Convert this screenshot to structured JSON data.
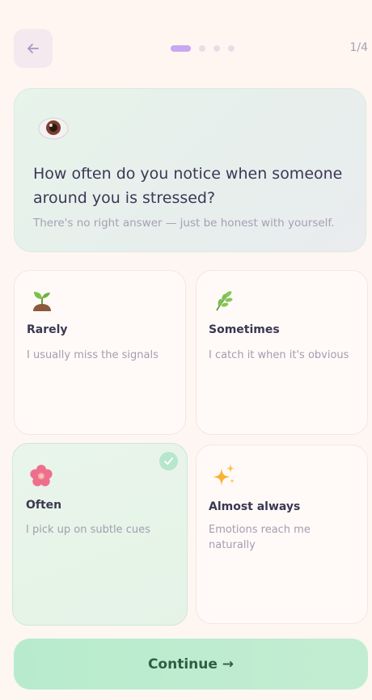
{
  "header": {
    "step_label": "1/4",
    "progress": {
      "current": 1,
      "total": 4
    }
  },
  "question": {
    "icon": "eye-icon",
    "title": "How often do you notice when someone around you is stressed?",
    "subtitle": "There's no right answer — just be honest with yourself."
  },
  "options": [
    {
      "icon": "seedling-icon",
      "title": "Rarely",
      "description": "I usually miss the signals",
      "selected": false
    },
    {
      "icon": "herb-icon",
      "title": "Sometimes",
      "description": "I catch it when it's obvious",
      "selected": false
    },
    {
      "icon": "blossom-icon",
      "title": "Often",
      "description": "I pick up on subtle cues",
      "selected": true
    },
    {
      "icon": "sparkles-icon",
      "title": "Almost always",
      "description": "Emotions reach me naturally",
      "selected": false
    }
  ],
  "continue_button": {
    "label": "Continue →"
  },
  "colors": {
    "accent_progress": "#c9a6f0",
    "selected_bg": "#e9f5ea",
    "continue_bg": "#b8ebcd",
    "continue_text": "#2f5e43"
  }
}
